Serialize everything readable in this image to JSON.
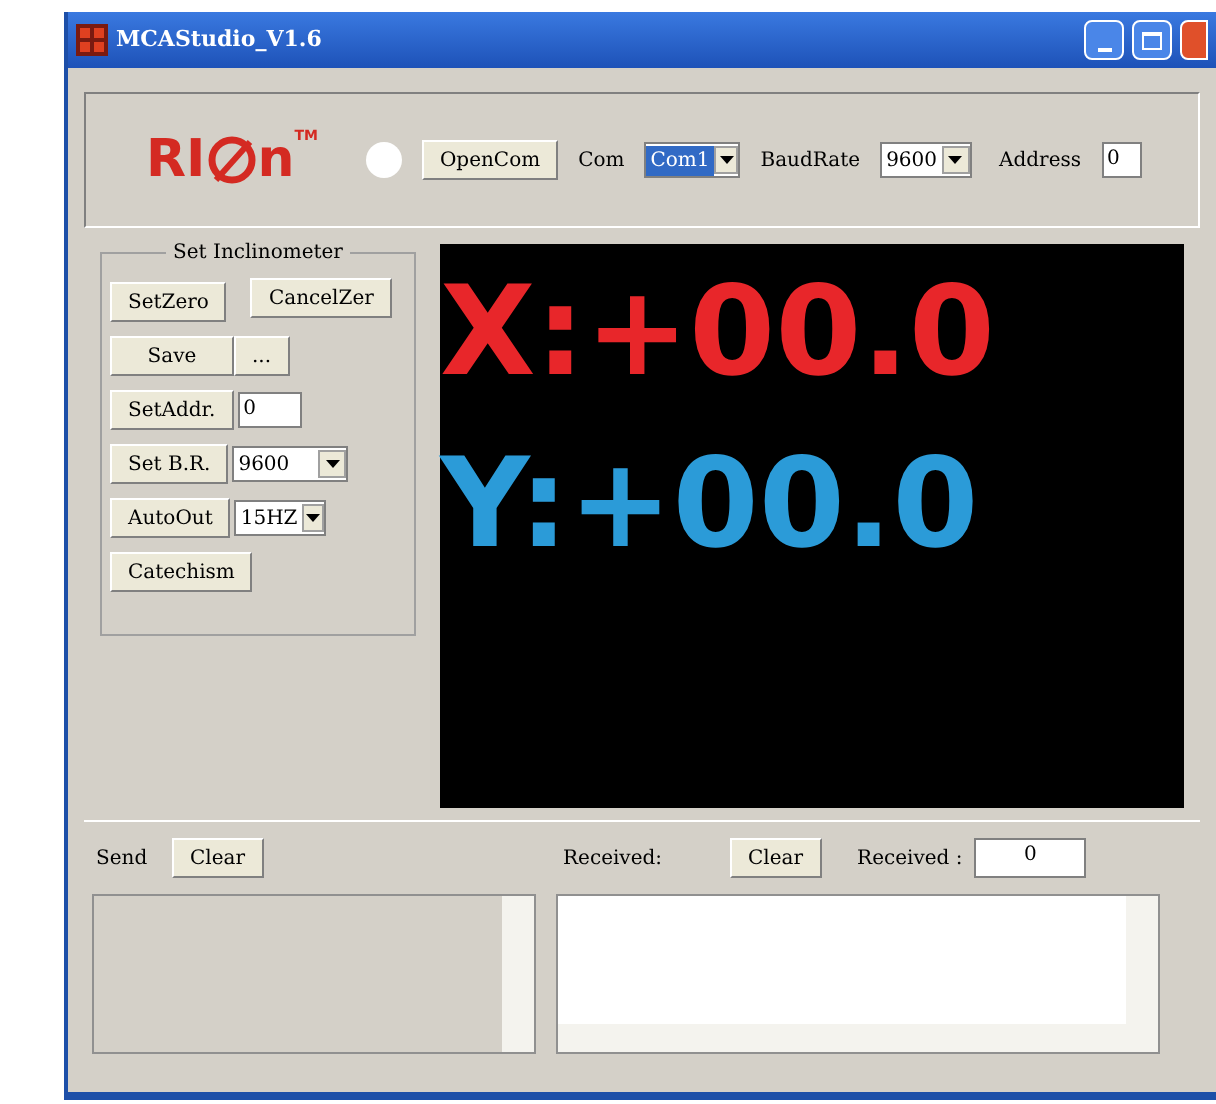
{
  "window": {
    "title": "MCAStudio_V1.6"
  },
  "toolbar": {
    "logo": {
      "left": "RI",
      "right": "n",
      "mark": "TM"
    },
    "connected": false,
    "open_button": "OpenCom",
    "com_label": "Com",
    "com_value": "Com1",
    "baud_label": "BaudRate",
    "baud_value": "9600",
    "address_label": "Address",
    "address_value": "0"
  },
  "inclinometer": {
    "title": "Set Inclinometer",
    "set_zero": "SetZero",
    "cancel_zero": "CancelZer",
    "save": "Save",
    "more": "...",
    "set_addr": "SetAddr.",
    "addr_value": "0",
    "set_br": "Set B.R.",
    "br_value": "9600",
    "auto_out": "AutoOut",
    "auto_value": "15HZ",
    "catechism": "Catechism"
  },
  "display": {
    "x": {
      "text": "X:+00.0",
      "color": "#e8262a"
    },
    "y": {
      "text": "Y:+00.0",
      "color": "#2b9bd8"
    }
  },
  "send": {
    "label": "Send",
    "clear": "Clear"
  },
  "received": {
    "label": "Received:",
    "clear": "Clear",
    "count_label": "Received :",
    "count": "0"
  }
}
